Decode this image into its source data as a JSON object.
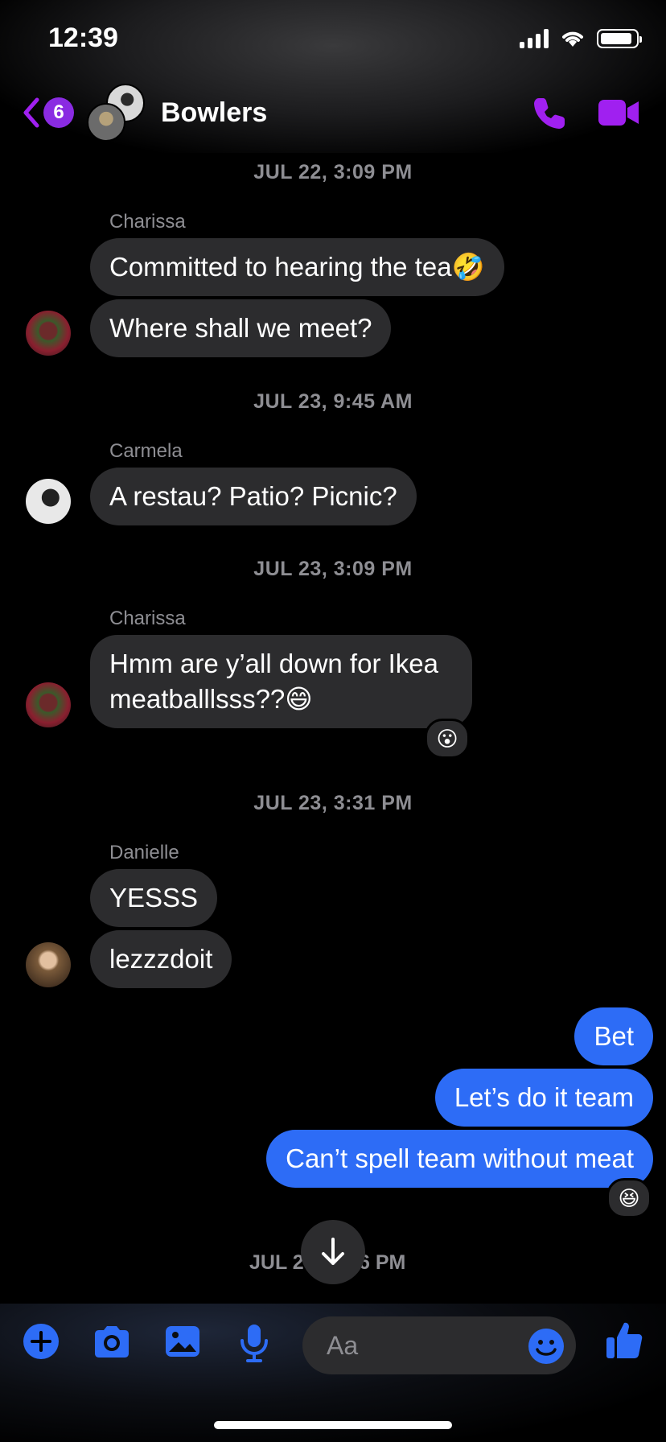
{
  "status_bar": {
    "time": "12:39"
  },
  "header": {
    "back_badge": "6",
    "title": "Bowlers"
  },
  "messages": [
    {
      "type": "timestamp",
      "text": "JUL 22, 3:09 PM"
    },
    {
      "type": "sender",
      "text": "Charissa"
    },
    {
      "type": "incoming",
      "text": "Committed to hearing the tea🤣"
    },
    {
      "type": "incoming",
      "text": "Where shall we meet?"
    },
    {
      "type": "timestamp",
      "text": "JUL 23, 9:45 AM"
    },
    {
      "type": "sender",
      "text": "Carmela"
    },
    {
      "type": "incoming",
      "text": "A restau? Patio? Picnic?"
    },
    {
      "type": "timestamp",
      "text": "JUL 23, 3:09 PM"
    },
    {
      "type": "sender",
      "text": "Charissa"
    },
    {
      "type": "incoming",
      "line1": "Hmm are y’all down for Ikea",
      "line2": "meatballlsss??😄",
      "reaction": "😮"
    },
    {
      "type": "timestamp",
      "text": "JUL 23, 3:31 PM"
    },
    {
      "type": "sender",
      "text": "Danielle"
    },
    {
      "type": "incoming",
      "text": "YESSS"
    },
    {
      "type": "incoming",
      "text": "lezzzdoit"
    },
    {
      "type": "outgoing",
      "text": "Bet"
    },
    {
      "type": "outgoing",
      "text": "Let’s do it team"
    },
    {
      "type": "outgoing",
      "text": "Can’t spell team without meat",
      "reaction": "😆"
    },
    {
      "type": "timestamp_partial",
      "left": "JUL 2",
      "right": "6 PM"
    }
  ],
  "composer": {
    "placeholder": "Aa",
    "icons": [
      "plus-icon",
      "camera-icon",
      "photo-icon",
      "microphone-icon",
      "emoji-icon",
      "thumbs-up-icon"
    ]
  },
  "colors": {
    "accent_purple": "#a020f0",
    "accent_blue": "#2d6cf6",
    "bubble_incoming": "#2c2c2e",
    "timestamp_gray": "#8e8e93"
  }
}
